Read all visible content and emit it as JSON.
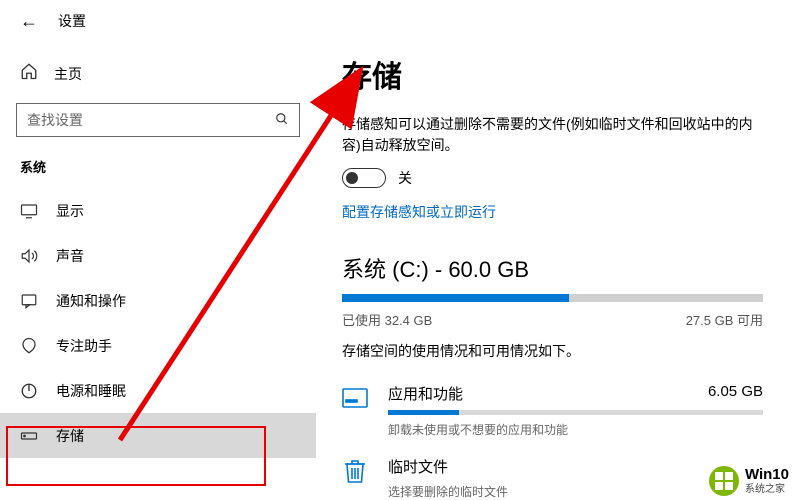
{
  "header": {
    "title": "设置"
  },
  "sidebar": {
    "home_label": "主页",
    "search_placeholder": "查找设置",
    "section_label": "系统",
    "items": [
      {
        "label": "显示"
      },
      {
        "label": "声音"
      },
      {
        "label": "通知和操作"
      },
      {
        "label": "专注助手"
      },
      {
        "label": "电源和睡眠"
      },
      {
        "label": "存储"
      }
    ]
  },
  "main": {
    "title": "存储",
    "sense_desc": "存储感知可以通过删除不需要的文件(例如临时文件和回收站中的内容)自动释放空间。",
    "toggle_state": "关",
    "config_link": "配置存储感知或立即运行",
    "drive": {
      "title": "系统 (C:) - 60.0 GB",
      "used_label": "已使用 32.4 GB",
      "free_label": "27.5 GB 可用",
      "used_ratio": 0.54
    },
    "usage_desc": "存储空间的使用情况和可用情况如下。",
    "categories": [
      {
        "name": "应用和功能",
        "size": "6.05 GB",
        "sub": "卸载未使用或不想要的应用和功能",
        "ratio": 0.19,
        "icon": "apps"
      },
      {
        "name": "临时文件",
        "sub": "选择要删除的临时文件",
        "icon": "trash"
      }
    ]
  },
  "watermark": {
    "main": "Win10",
    "sub": "系统之家"
  }
}
